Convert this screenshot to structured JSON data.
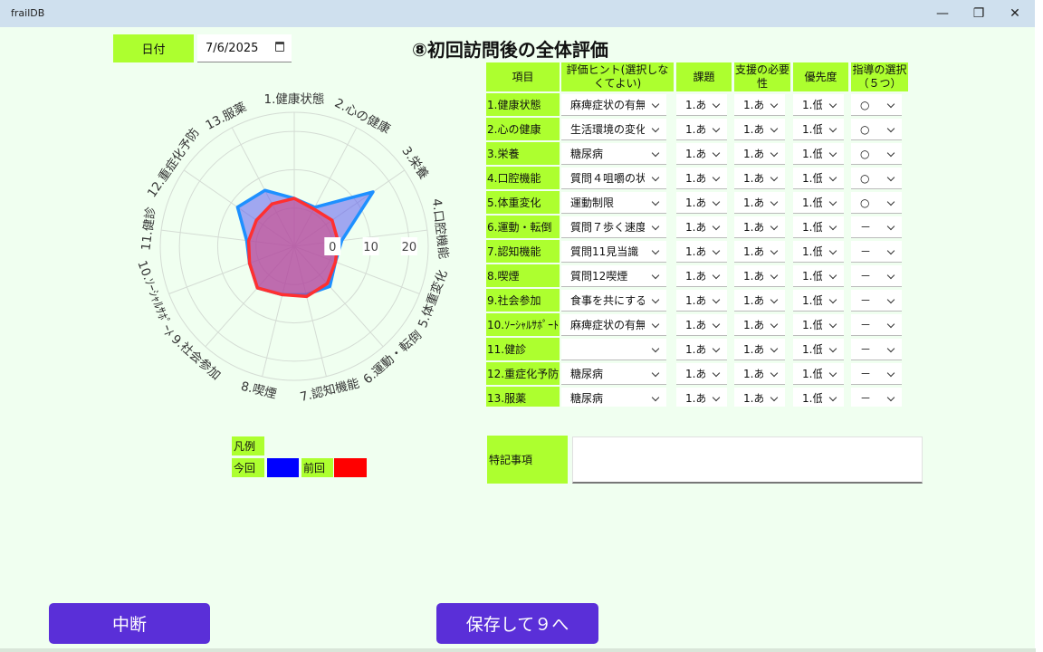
{
  "window": {
    "title": "frailDB",
    "minimize_glyph": "—",
    "maximize_glyph": "❐",
    "close_glyph": "✕"
  },
  "date": {
    "label": "日付",
    "value": "7/6/2025"
  },
  "page_title": "⑧初回訪問後の全体評価",
  "table": {
    "headers": {
      "item": "項目",
      "hint": "評価ヒント(選択しなくてよい)",
      "issue": "課題",
      "need": "支援の必要性",
      "priority": "優先度",
      "guidance": "指導の選択（５つ）"
    },
    "rows": [
      {
        "label": "1.健康状態",
        "hint": "麻痺症状の有無",
        "issue": "1.あ",
        "need": "1.あ",
        "priority": "1.低",
        "guidance": "○"
      },
      {
        "label": "2.心の健康",
        "hint": "生活環境の変化",
        "issue": "1.あ",
        "need": "1.あ",
        "priority": "1.低",
        "guidance": "○"
      },
      {
        "label": "3.栄養",
        "hint": "糖尿病",
        "issue": "1.あ",
        "need": "1.あ",
        "priority": "1.低",
        "guidance": "○"
      },
      {
        "label": "4.口腔機能",
        "hint": "質問４咀嚼の状",
        "issue": "1.あ",
        "need": "1.あ",
        "priority": "1.低",
        "guidance": "○"
      },
      {
        "label": "5.体重変化",
        "hint": "運動制限",
        "issue": "1.あ",
        "need": "1.あ",
        "priority": "1.低",
        "guidance": "○"
      },
      {
        "label": "6.運動・転倒",
        "hint": "質問７歩く速度",
        "issue": "1.あ",
        "need": "1.あ",
        "priority": "1.低",
        "guidance": "－"
      },
      {
        "label": "7.認知機能",
        "hint": "質問11見当識",
        "issue": "1.あ",
        "need": "1.あ",
        "priority": "1.低",
        "guidance": "－"
      },
      {
        "label": "8.喫煙",
        "hint": "質問12喫煙",
        "issue": "1.あ",
        "need": "1.あ",
        "priority": "1.低",
        "guidance": "－"
      },
      {
        "label": "9.社会参加",
        "hint": "食事を共にする人",
        "issue": "1.あ",
        "need": "1.あ",
        "priority": "1.低",
        "guidance": "－"
      },
      {
        "label": "10.ｿｰｼｬﾙｻﾎﾟｰﾄ",
        "hint": "麻痺症状の有無",
        "issue": "1.あ",
        "need": "1.あ",
        "priority": "1.低",
        "guidance": "－"
      },
      {
        "label": "11.健診",
        "hint": "",
        "issue": "1.あ",
        "need": "1.あ",
        "priority": "1.低",
        "guidance": "－"
      },
      {
        "label": "12.重症化予防",
        "hint": "糖尿病",
        "issue": "1.あ",
        "need": "1.あ",
        "priority": "1.低",
        "guidance": "－"
      },
      {
        "label": "13.服薬",
        "hint": "糖尿病",
        "issue": "1.あ",
        "need": "1.あ",
        "priority": "1.低",
        "guidance": "－"
      }
    ]
  },
  "legend": {
    "title": "凡例",
    "current_label": "今回",
    "previous_label": "前回"
  },
  "colors": {
    "accent": "#adff2f",
    "button": "#5a2fd8",
    "current_swatch": "#0000ff",
    "previous_swatch": "#ff0000",
    "current_line": "#1e90ff",
    "previous_line": "#ff3030"
  },
  "remarks": {
    "label": "特記事項",
    "value": ""
  },
  "buttons": {
    "pause": "中断",
    "save_next": "保存して９へ"
  },
  "chart_data": {
    "type": "radar",
    "categories": [
      "1.健康状態",
      "2.心の健康",
      "3.栄養",
      "4.口腔機能",
      "5.体重変化",
      "6.運動・転倒",
      "7.認知機能",
      "8.喫煙",
      "9.社会参加",
      "10.ｿｰｼｬﾙｻﾎﾟｰﾄ",
      "11.健診",
      "12.重症化予防",
      "13.服薬"
    ],
    "radial_ticks": [
      "0",
      "10",
      "20"
    ],
    "rmin": -10,
    "rmax": 25,
    "grid": true,
    "series": [
      {
        "name": "今回",
        "values": [
          2.5,
          1.5,
          15,
          2.5,
          1.5,
          4,
          3,
          3,
          4.5,
          2.5,
          2.5,
          8,
          6.5
        ]
      },
      {
        "name": "前回",
        "values": [
          2.5,
          1,
          2,
          1.5,
          1.5,
          3,
          3.5,
          3,
          4.5,
          2.5,
          2,
          2,
          2.5
        ]
      }
    ]
  }
}
